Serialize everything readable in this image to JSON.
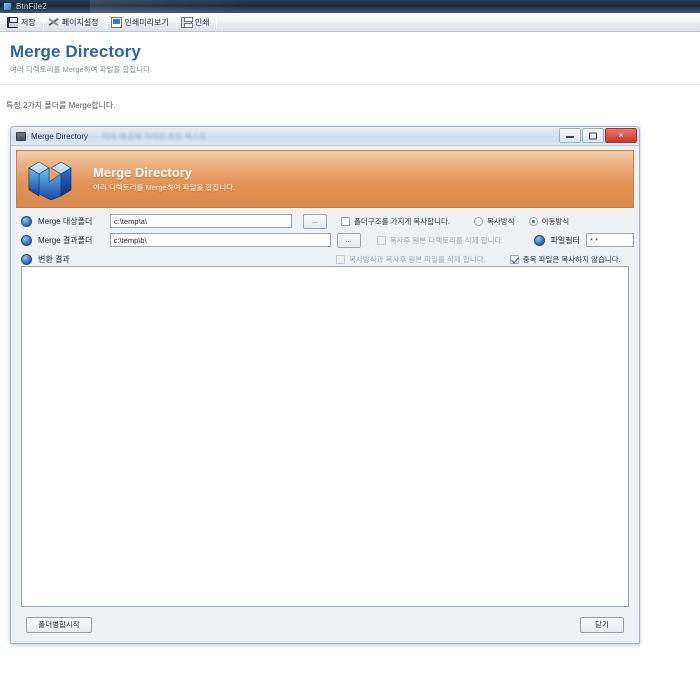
{
  "app": {
    "window_title": "BtnFile2",
    "icon": "app-icon"
  },
  "toolbar": {
    "items": [
      {
        "label": "저장",
        "icon": "save-icon"
      },
      {
        "label": "페이지설정",
        "icon": "page-setup-icon"
      },
      {
        "label": "인쇄미리보기",
        "icon": "print-preview-icon"
      },
      {
        "label": "인쇄",
        "icon": "print-icon"
      }
    ]
  },
  "page": {
    "title": "Merge Directory",
    "subtitle": "여러 디렉토리를 Merge하여 파일을 합칩니다.",
    "note": "특정 2가지 폴더를 Merge합니다."
  },
  "dialog": {
    "titlebar": {
      "icon": "window-icon",
      "title": "Merge Directory",
      "ghost": "미리 배경에 가려진 흐린 텍스트",
      "minimize_label": "최소화",
      "maximize_label": "최대화",
      "close_label": "✕"
    },
    "banner": {
      "icon": "merge-cubes-icon",
      "title": "Merge Directory",
      "subtitle": "여러 디렉토리를 Merge하여 파일을 합칩니다."
    },
    "fields": {
      "source": {
        "label": "Merge 대상폴더",
        "value": "c:\\temp\\a\\",
        "placeholder": "",
        "browse_label": "..."
      },
      "target": {
        "label": "Merge 결과폴더",
        "value": "c:\\temp\\b\\",
        "placeholder": "",
        "browse_label": "..."
      },
      "result": {
        "label": "변환 결과"
      },
      "filter": {
        "label": "파일필터",
        "value": "*.*",
        "placeholder": ""
      }
    },
    "options": {
      "keep_structure": {
        "label": "폴더구조를 가지게 복사합니다.",
        "checked": false,
        "disabled": false
      },
      "delete_source_dir": {
        "label": "복사후 원본 디렉토리를 삭제 합니다.",
        "checked": false,
        "disabled": true
      },
      "delete_source_file": {
        "label": "복사방식과 복사후 원본 파일를 삭제 합니다.",
        "checked": false,
        "disabled": true
      },
      "skip_duplicates": {
        "label": "중복 파일은 복사하지 않습니다.",
        "checked": true,
        "disabled": false
      }
    },
    "mode": {
      "copy": {
        "label": "복사방식",
        "selected": false
      },
      "move": {
        "label": "이동방식",
        "selected": true
      }
    },
    "buttons": {
      "start": "폴더병합시작",
      "close": "닫기"
    }
  },
  "colors": {
    "page_title": "#2b64a8",
    "banner_start": "#f4cfae",
    "banner_end": "#d98a4b",
    "close_button": "#c8382c",
    "bullet": "#2a6fb5"
  }
}
